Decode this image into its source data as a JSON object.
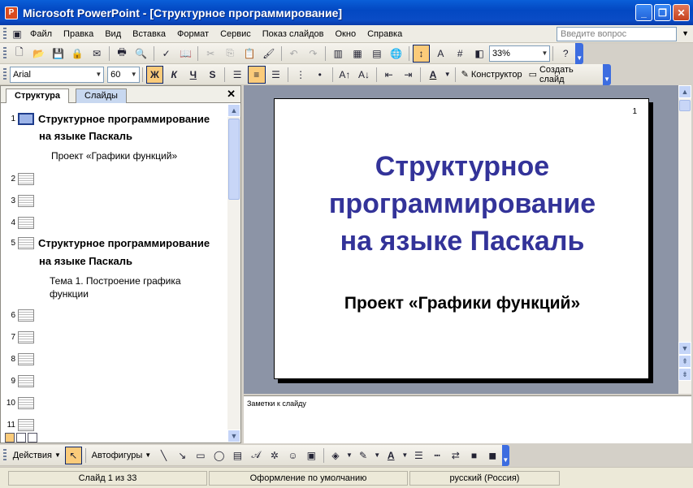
{
  "window": {
    "title": "Microsoft PowerPoint - [Структурное программирование]"
  },
  "menu": {
    "items": [
      "Файл",
      "Правка",
      "Вид",
      "Вставка",
      "Формат",
      "Сервис",
      "Показ слайдов",
      "Окно",
      "Справка"
    ],
    "help_placeholder": "Введите вопрос"
  },
  "standard_toolbar": {
    "zoom": "33%"
  },
  "format_toolbar": {
    "font": "Arial",
    "size": "60",
    "bold": "Ж",
    "italic": "К",
    "underline": "Ч",
    "shadow": "S",
    "designer": "Конструктор",
    "new_slide": "Создать слайд"
  },
  "left_pane": {
    "tabs": [
      "Структура",
      "Слайды"
    ],
    "outline": [
      {
        "num": "1",
        "title_line1": "Структурное программирование",
        "title_line2": "на языке Паскаль",
        "sub": "Проект «Графики функций»"
      },
      {
        "num": "2"
      },
      {
        "num": "3"
      },
      {
        "num": "4"
      },
      {
        "num": "5",
        "title_line1": "Структурное программирование",
        "title_line2": "на языке Паскаль",
        "sub_line1": "Тема 1. Построение графика",
        "sub_line2": "функции"
      },
      {
        "num": "6"
      },
      {
        "num": "7"
      },
      {
        "num": "8"
      },
      {
        "num": "9"
      },
      {
        "num": "10"
      },
      {
        "num": "11"
      }
    ]
  },
  "slide": {
    "number": "1",
    "title_line1": "Структурное",
    "title_line2": "программирование",
    "title_line3": "на языке Паскаль",
    "subtitle": "Проект «Графики функций»"
  },
  "notes": {
    "placeholder": "Заметки к слайду"
  },
  "drawing_toolbar": {
    "actions": "Действия",
    "autoshapes": "Автофигуры"
  },
  "status": {
    "slide": "Слайд 1 из 33",
    "design": "Оформление по умолчанию",
    "language": "русский (Россия)"
  }
}
